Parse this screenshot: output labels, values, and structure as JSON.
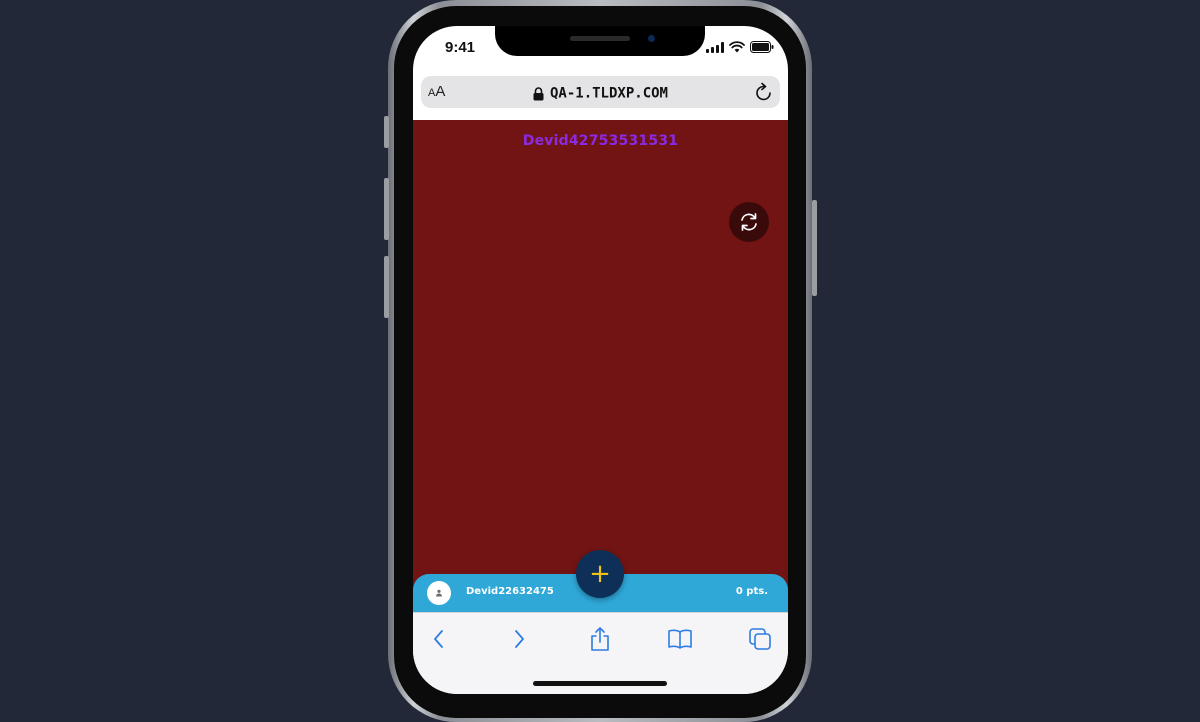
{
  "status_bar": {
    "time": "9:41"
  },
  "browser": {
    "text_size_small": "A",
    "text_size_large": "A",
    "url": "QA-1.TLDXP.COM"
  },
  "page": {
    "title": "Devid42753531531",
    "background": "#721414",
    "title_color": "#8a2be2"
  },
  "player": {
    "name": "Devid22632475",
    "points": "0 pts."
  },
  "add_button": {
    "label": "+"
  },
  "icons": {
    "lock": "lock-icon",
    "reload": "reload-icon",
    "refresh": "refresh-icon",
    "avatar": "user-icon",
    "back": "chevron-left-icon",
    "forward": "chevron-right-icon",
    "share": "share-icon",
    "bookmarks": "book-icon",
    "tabs": "tabs-icon"
  },
  "colors": {
    "player_bar": "#2fa8d8",
    "add_button": "#0e2f57",
    "add_symbol": "#f2c21b",
    "toolbar_icons": "#2f7de1"
  }
}
